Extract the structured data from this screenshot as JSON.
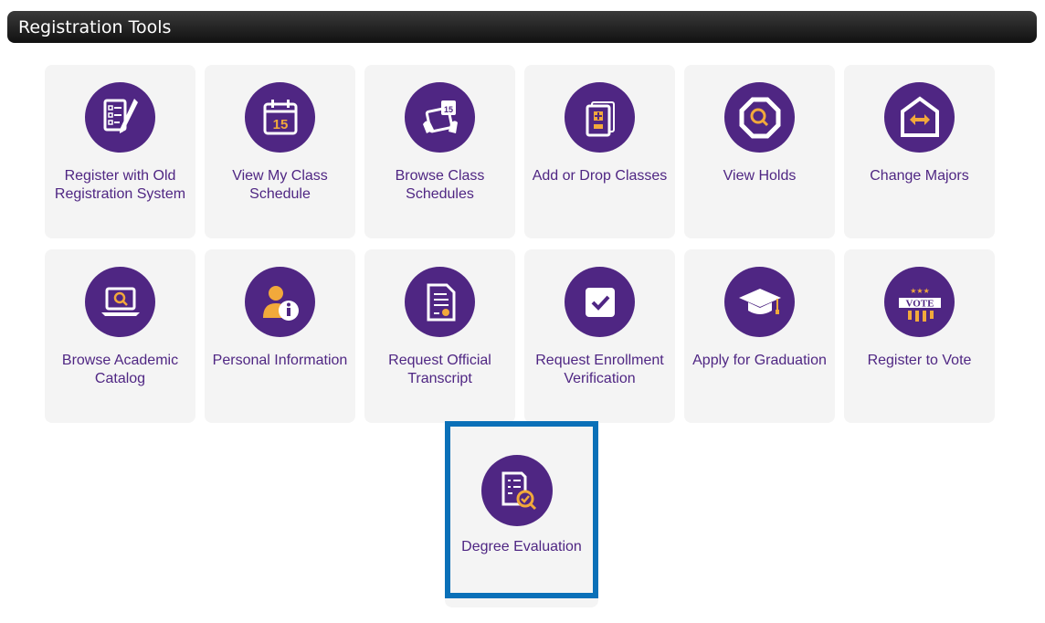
{
  "header": {
    "title": "Registration Tools"
  },
  "tiles": [
    {
      "label": "Register with Old Registration System",
      "icon": "checklist-pencil-icon"
    },
    {
      "label": "View My Class Schedule",
      "icon": "calendar-icon"
    },
    {
      "label": "Browse Class Schedules",
      "icon": "calendar-tablet-icon"
    },
    {
      "label": "Add or Drop Classes",
      "icon": "add-drop-document-icon"
    },
    {
      "label": "View Holds",
      "icon": "stop-sign-search-icon"
    },
    {
      "label": "Change Majors",
      "icon": "arrows-exchange-icon"
    },
    {
      "label": "Browse Academic Catalog",
      "icon": "laptop-search-icon"
    },
    {
      "label": "Personal Information",
      "icon": "user-info-icon"
    },
    {
      "label": "Request Official Transcript",
      "icon": "certificate-document-icon"
    },
    {
      "label": "Request Enrollment Verification",
      "icon": "checkbox-icon"
    },
    {
      "label": "Apply for Graduation",
      "icon": "graduation-cap-icon"
    },
    {
      "label": "Register to Vote",
      "icon": "vote-badge-icon"
    },
    {
      "label": "Degree Evaluation",
      "icon": "document-check-icon"
    }
  ],
  "colors": {
    "accent": "#4f2683",
    "gold": "#f2a93b",
    "tile_bg": "#f4f4f4",
    "highlight": "#0a70b8"
  }
}
